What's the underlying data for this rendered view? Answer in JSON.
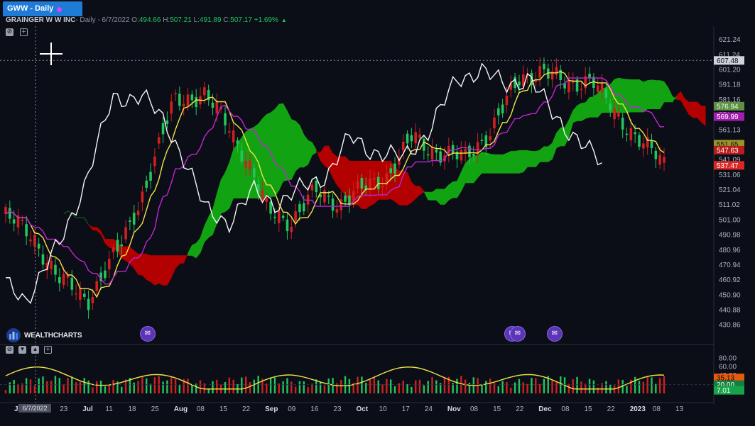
{
  "tab": {
    "label": "GWW - Daily",
    "dot_color": "#e040fb"
  },
  "header": {
    "company": "GRAINGER W W INC",
    "meta": " - Daily - 6/7/2022",
    "o_label": "O:",
    "o_value": "494.66",
    "h_label": "H:",
    "h_value": "507.21",
    "l_label": "L:",
    "l_value": "491.89",
    "c_label": "C:",
    "c_value": "507.17",
    "change": "+1.69%"
  },
  "brand": {
    "name": "WEALTHCHARTS"
  },
  "crosshair_date": "6/7/2022",
  "colors": {
    "bull": "#22c55e",
    "bear": "#d21f1f",
    "tenkan": "#f0e44a",
    "kijun": "#c026d3",
    "chikou": "#f5f5f5",
    "kumo_bull": "#12a312",
    "kumo_bear": "#b30000",
    "rsi": "#f0e44a"
  },
  "chart_data": [
    {
      "type": "candlestick",
      "title": "",
      "indicator": "Ichimoku Cloud",
      "ylim": [
        426,
        627
      ],
      "y_ticks": [
        "621.24",
        "611.24",
        "601.20",
        "591.18",
        "581.16",
        "571.14",
        "561.13",
        "551.11",
        "541.09",
        "531.06",
        "521.04",
        "511.02",
        "501.00",
        "490.98",
        "480.96",
        "470.94",
        "460.92",
        "450.90",
        "440.88",
        "430.86"
      ],
      "x_tick_labels": [
        "Ju",
        "15",
        "23",
        "Jul",
        "11",
        "18",
        "25",
        "Aug",
        "08",
        "15",
        "22",
        "Sep",
        "09",
        "16",
        "23",
        "Oct",
        "10",
        "17",
        "24",
        "Nov",
        "08",
        "15",
        "22",
        "Dec",
        "08",
        "15",
        "22",
        "2023",
        "08",
        "13"
      ],
      "price_tags": [
        {
          "label": "crosshair",
          "value": "607.48",
          "color": "#d0d3dc",
          "text_color": "#111111"
        },
        {
          "label": "kumo-span-a",
          "value": "576.94",
          "color": "#5f8f45",
          "text_color": "#e8ffe0"
        },
        {
          "label": "kijun",
          "value": "569.99",
          "color": "#a21caf",
          "text_color": "#ffffff"
        },
        {
          "label": "tenkan",
          "value": "551.65",
          "color": "#9a9428",
          "text_color": "#111111"
        },
        {
          "label": "kumo-span-b",
          "value": "547.63",
          "color": "#b91c1c",
          "text_color": "#ffffff"
        },
        {
          "label": "last-price",
          "value": "537.47",
          "color": "#dc2626",
          "text_color": "#ffffff"
        }
      ],
      "crosshair_price": 607.48
    },
    {
      "type": "bar+line",
      "title": "",
      "indicator": "Volume / Oscillator",
      "ylim": [
        0,
        95
      ],
      "y_ticks": [
        "80.00",
        "60.00",
        "40.00",
        "20.00"
      ],
      "price_tags": [
        {
          "label": "osc-value",
          "value": "35.13",
          "color": "#ea580c",
          "text_color": "#111111"
        },
        {
          "label": "osc-level",
          "value": "20.00",
          "color": "#15803d",
          "text_color": "#ffffff"
        },
        {
          "label": "osc-low",
          "value": "7.01",
          "color": "#16a34a",
          "text_color": "#ffffff"
        }
      ]
    }
  ]
}
